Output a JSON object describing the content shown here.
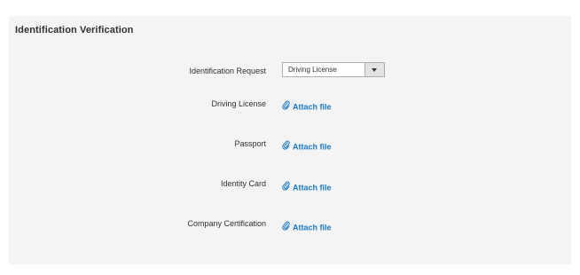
{
  "section": {
    "title": "Identification Verification"
  },
  "form": {
    "identification_request": {
      "label": "Identification Request",
      "selected": "Driving License"
    },
    "documents": [
      {
        "label": "Driving License",
        "action": "Attach file",
        "icon": "paperclip-icon"
      },
      {
        "label": "Passport",
        "action": "Attach file",
        "icon": "paperclip-icon"
      },
      {
        "label": "Identity Card",
        "action": "Attach file",
        "icon": "paperclip-icon"
      },
      {
        "label": "Company Certification",
        "action": "Attach file",
        "icon": "paperclip-icon"
      }
    ]
  },
  "colors": {
    "panel_bg": "#f4f4f4",
    "link": "#1979c3",
    "text": "#303030"
  }
}
